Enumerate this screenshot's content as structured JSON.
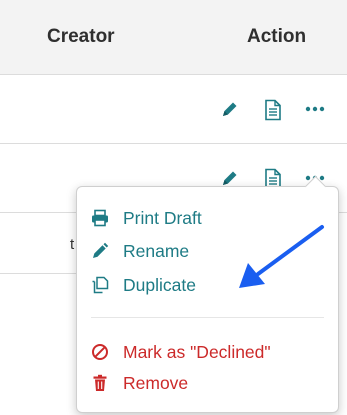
{
  "table": {
    "columns": {
      "creator": "Creator",
      "action": "Action"
    },
    "row3_partial_text": "t"
  },
  "icons": {
    "edit": "pencil-icon",
    "doc": "document-icon",
    "more": "ellipsis-icon"
  },
  "menu": {
    "print_draft": "Print Draft",
    "rename": "Rename",
    "duplicate": "Duplicate",
    "mark_declined": "Mark as \"Declined\"",
    "remove": "Remove"
  },
  "colors": {
    "teal": "#1e7b85",
    "red": "#cc2a2a",
    "annotation_arrow": "#1a5ef0"
  }
}
